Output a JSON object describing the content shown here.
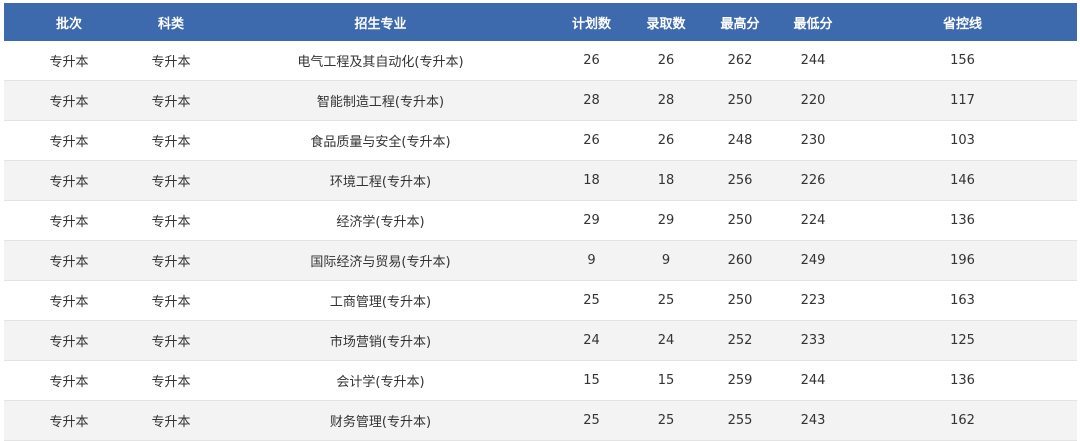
{
  "table": {
    "headers": [
      "批次",
      "科类",
      "招生专业",
      "计划数",
      "录取数",
      "最高分",
      "最低分",
      "省控线"
    ],
    "rows": [
      [
        "专升本",
        "专升本",
        "电气工程及其自动化(专升本)",
        "26",
        "26",
        "262",
        "244",
        "156"
      ],
      [
        "专升本",
        "专升本",
        "智能制造工程(专升本)",
        "28",
        "28",
        "250",
        "220",
        "117"
      ],
      [
        "专升本",
        "专升本",
        "食品质量与安全(专升本)",
        "26",
        "26",
        "248",
        "230",
        "103"
      ],
      [
        "专升本",
        "专升本",
        "环境工程(专升本)",
        "18",
        "18",
        "256",
        "226",
        "146"
      ],
      [
        "专升本",
        "专升本",
        "经济学(专升本)",
        "29",
        "29",
        "250",
        "224",
        "136"
      ],
      [
        "专升本",
        "专升本",
        "国际经济与贸易(专升本)",
        "9",
        "9",
        "260",
        "249",
        "196"
      ],
      [
        "专升本",
        "专升本",
        "工商管理(专升本)",
        "25",
        "25",
        "250",
        "223",
        "163"
      ],
      [
        "专升本",
        "专升本",
        "市场营销(专升本)",
        "24",
        "24",
        "252",
        "233",
        "125"
      ],
      [
        "专升本",
        "专升本",
        "会计学(专升本)",
        "15",
        "15",
        "259",
        "244",
        "136"
      ],
      [
        "专升本",
        "专升本",
        "财务管理(专升本)",
        "25",
        "25",
        "255",
        "243",
        "162"
      ]
    ]
  },
  "colors": {
    "header_bg": "#3d69ad",
    "header_text": "#ffffff",
    "row_alt_bg": "#f3f3f3"
  }
}
